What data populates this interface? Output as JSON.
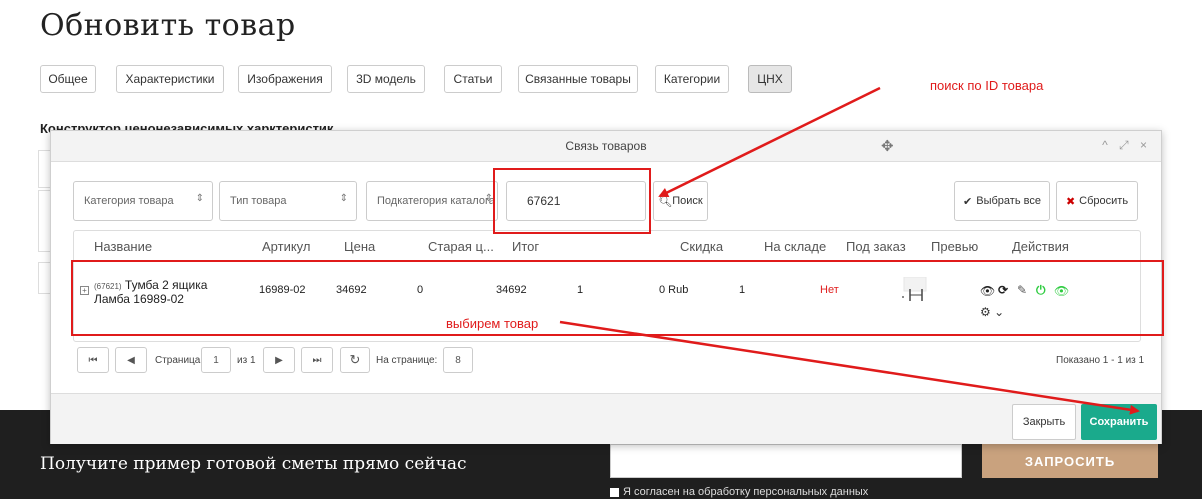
{
  "page": {
    "title": "Обновить товар",
    "tabs": [
      "Общее",
      "Характеристики",
      "Изображения",
      "3D модель",
      "Статьи",
      "Связанные товары",
      "Категории",
      "ЦНХ"
    ],
    "section_title": "Конструктор ценонезависимых харктеристик"
  },
  "modal": {
    "title": "Связь товаров",
    "header_controls": "^ ⤢ ×",
    "filters": {
      "category": "Категория товара",
      "type": "Тип товара",
      "subcategory": "Подкатегория каталога",
      "search_value": "67621",
      "search_button": "Поиск"
    },
    "select_all": "Выбрать все",
    "reset": "Сбросить",
    "columns": [
      "Название",
      "Артикул",
      "Цена",
      "Старая ц...",
      "Итог",
      "Скидка",
      "На складе",
      "Под заказ",
      "Превью",
      "Действия"
    ],
    "row": {
      "id": "(67621)",
      "name_line1": "Тумба 2 ящика",
      "name_line2": "Ламба 16989-02",
      "article": "16989-02",
      "price": "34692",
      "old_price": "0",
      "total": "34692",
      "qty": "1",
      "discount": "0 Rub",
      "stock": "1",
      "stock_status": "Нет"
    },
    "pager": {
      "page_label": "Страница",
      "page": "1",
      "of_label": "из 1",
      "per_page_label": "На странице:",
      "per_page": "8",
      "shown": "Показано 1 - 1 из 1"
    },
    "close": "Закрыть",
    "save": "Сохранить"
  },
  "annotations": {
    "search_hint": "поиск по ID товара",
    "select_hint": "выбирем товар"
  },
  "footer": {
    "text": "Получите пример готовой сметы прямо сейчас",
    "button": "ЗАПРОСИТЬ",
    "consent": "Я согласен на обработку персональных данных"
  },
  "colors": {
    "accent_green": "#1aaa8c",
    "annotation_red": "#e01b1b",
    "footer_bg": "#1f1f1f",
    "footer_button": "#c9a27e"
  }
}
